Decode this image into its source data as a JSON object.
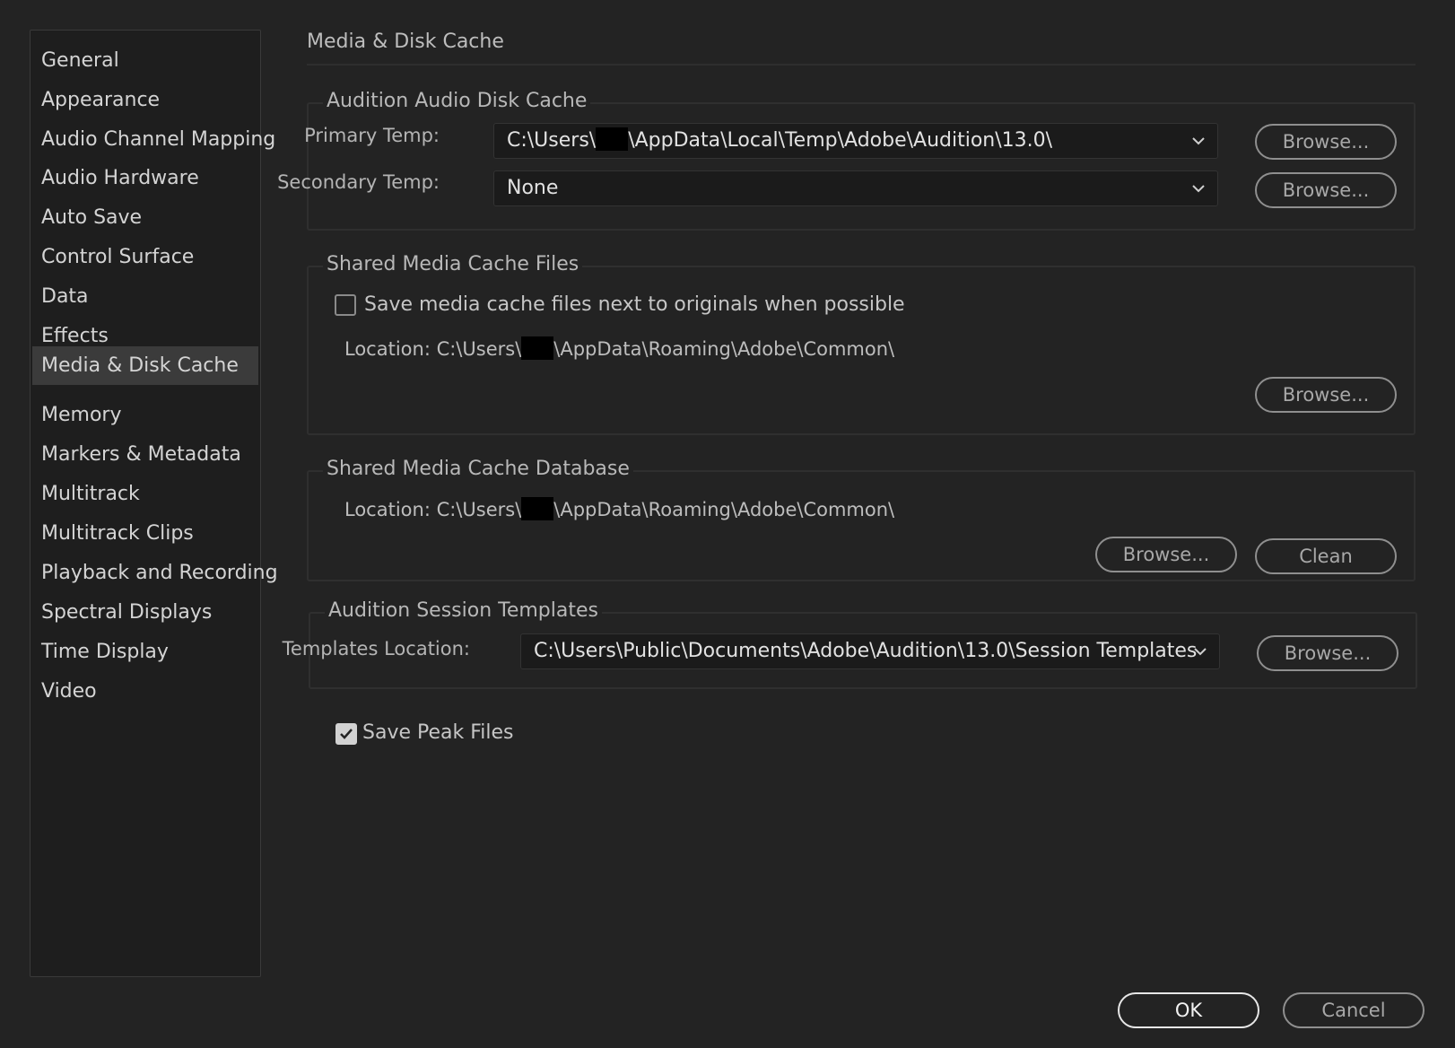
{
  "sidebar": {
    "items": [
      {
        "label": "General"
      },
      {
        "label": "Appearance"
      },
      {
        "label": "Audio Channel Mapping"
      },
      {
        "label": "Audio Hardware"
      },
      {
        "label": "Auto Save"
      },
      {
        "label": "Control Surface"
      },
      {
        "label": "Data"
      },
      {
        "label": "Effects"
      },
      {
        "label": "Media & Disk Cache"
      },
      {
        "label": "Memory"
      },
      {
        "label": "Markers & Metadata"
      },
      {
        "label": "Multitrack"
      },
      {
        "label": "Multitrack Clips"
      },
      {
        "label": "Playback and Recording"
      },
      {
        "label": "Spectral Displays"
      },
      {
        "label": "Time Display"
      },
      {
        "label": "Video"
      }
    ],
    "selected": "Media & Disk Cache"
  },
  "page": {
    "title": "Media & Disk Cache"
  },
  "disk_cache": {
    "title": "Audition Audio Disk Cache",
    "primary_label": "Primary Temp:",
    "primary_value_prefix": "C:\\Users\\",
    "primary_value_suffix": "\\AppData\\Local\\Temp\\Adobe\\Audition\\13.0\\",
    "secondary_label": "Secondary Temp:",
    "secondary_value": "None",
    "browse_label": "Browse..."
  },
  "cache_files": {
    "title": "Shared Media Cache Files",
    "checkbox_label": "Save media cache files next to originals when possible",
    "checked": false,
    "location_prefix": "Location: C:\\Users\\",
    "location_suffix": "\\AppData\\Roaming\\Adobe\\Common\\",
    "browse_label": "Browse..."
  },
  "cache_db": {
    "title": "Shared Media Cache Database",
    "location_prefix": "Location: C:\\Users\\",
    "location_suffix": "\\AppData\\Roaming\\Adobe\\Common\\",
    "browse_label": "Browse...",
    "clean_label": "Clean"
  },
  "templates": {
    "title": "Audition Session Templates",
    "location_label": "Templates Location:",
    "location_value": "C:\\Users\\Public\\Documents\\Adobe\\Audition\\13.0\\Session Templates",
    "browse_label": "Browse..."
  },
  "peak_files": {
    "label": "Save Peak Files",
    "checked": true
  },
  "footer": {
    "ok_label": "OK",
    "cancel_label": "Cancel"
  },
  "colors": {
    "background": "#232323",
    "sidebar": "#1e1e1e",
    "selected": "#3b3b3b"
  }
}
